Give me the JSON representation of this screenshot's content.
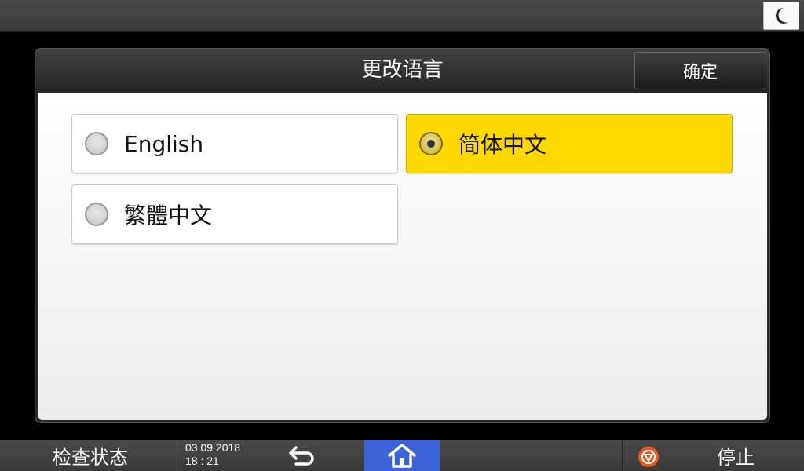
{
  "top_bar": {
    "sleep_icon": "moon-icon"
  },
  "dialog": {
    "title": "更改语言",
    "ok_label": "确定",
    "options": [
      {
        "label": "English",
        "selected": false
      },
      {
        "label": "简体中文",
        "selected": true
      },
      {
        "label": "繁體中文",
        "selected": false
      }
    ]
  },
  "bottom_bar": {
    "status_label": "检查状态",
    "date": "03 09 2018",
    "time": "18 : 21",
    "stop_label": "停止",
    "back_icon": "back-arrow-icon",
    "home_icon": "home-icon",
    "stop_icon": "stop-icon"
  },
  "colors": {
    "selected": "#ffd800",
    "home_button": "#3c64d8",
    "stop_icon": "#e85a1e"
  }
}
